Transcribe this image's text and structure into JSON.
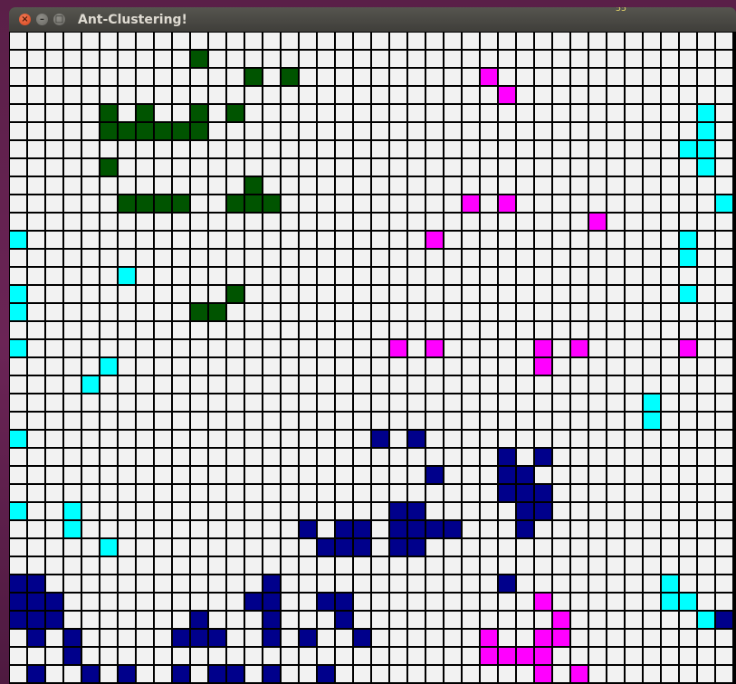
{
  "window": {
    "title": "Ant-Clustering!",
    "controls": {
      "close_icon": "close-icon",
      "minimize_icon": "minimize-icon",
      "maximize_icon": "maximize-icon"
    }
  },
  "desktop": {
    "corner_text": "55"
  },
  "colors": {
    "background": "#f2f2f2",
    "gridline": "#000000",
    "dark_green": "#005400",
    "magenta": "#ff00ff",
    "cyan": "#00ffff",
    "navy": "#00008b"
  },
  "grid": {
    "cols": 40,
    "rows": 36,
    "legend": {
      ".": "empty",
      "G": "dark_green",
      "M": "magenta",
      "C": "cyan",
      "N": "navy"
    },
    "cells": [
      "..........................................",
      "..........G..............................",
      ".............G.G..........M..............",
      "...........................M.............",
      ".....G.G..G.G.........................C..",
      ".....GGGGGG...........................C..",
      ".....................................CC.CC",
      ".....G................................C..",
      ".............G...........................",
      "......GGGG..GGG..........M.M...........C",
      "................................M........",
      "C......................M.............C...",
      ".....................................C..C",
      "......C..................................",
      "C...........G........................C...",
      "C.........GG.............................",
      "..........................................",
      "C....................M.M.....M.M.....M...",
      ".....C.......................M...........",
      "....C...................................C",
      "...................................C.....",
      "...................................C.....",
      "C...................N.N..................",
      "...........................N.N..........",
      ".......................N...NN............",
      "...........................NNN..........",
      "C..C.................NN.....NN..........",
      "...C............N.NN.NNNN...N...........",
      ".....C...........NNN.NN................",
      "..........................................",
      "NN............N............N........C...",
      "NNN..........NN..NN..........M......CC..",
      "NNN.......N...N...N...........M.......CN",
      ".N.N.....NNN..N.N..N......M..MM.........",
      "...N......................MMMM...........",
      ".N..N.N..N.NN.N..N...........M.M..........NNN"
    ]
  }
}
